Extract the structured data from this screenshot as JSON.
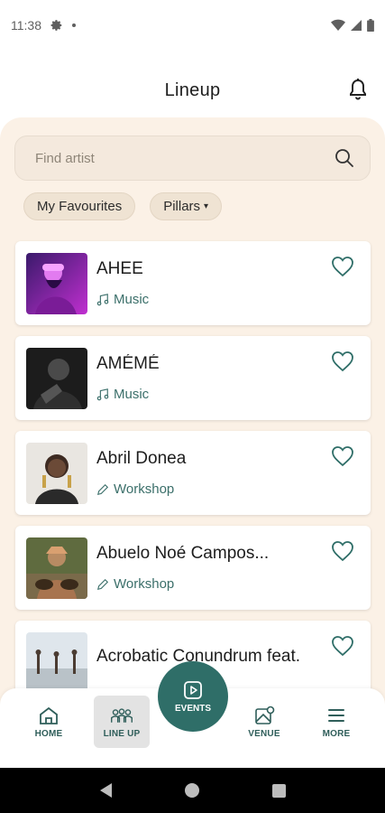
{
  "status_bar": {
    "time": "11:38"
  },
  "header": {
    "title": "Lineup"
  },
  "search": {
    "placeholder": "Find artist"
  },
  "filters": [
    {
      "label": "My Favourites"
    },
    {
      "label": "Pillars",
      "caret": "▾"
    }
  ],
  "artists": [
    {
      "name": "AHEE",
      "pillar": "Music",
      "pillar_icon": "music-note-icon",
      "favourite": false
    },
    {
      "name": "AMÉMÉ",
      "pillar": "Music",
      "pillar_icon": "music-note-icon",
      "favourite": false
    },
    {
      "name": "Abril Donea",
      "pillar": "Workshop",
      "pillar_icon": "pencil-icon",
      "favourite": false
    },
    {
      "name": "Abuelo Noé Campos...",
      "pillar": "Workshop",
      "pillar_icon": "pencil-icon",
      "favourite": false
    },
    {
      "name": "Acrobatic Conundrum feat.",
      "pillar": "",
      "pillar_icon": "",
      "favourite": false
    }
  ],
  "nav": {
    "home": "HOME",
    "lineup": "LINE UP",
    "events": "EVENTS",
    "venue": "VENUE",
    "more": "MORE",
    "active": "lineup"
  },
  "colors": {
    "accent": "#2f6e68",
    "teal_text": "#3b6f6a",
    "panel_bg": "#fbf1e6",
    "search_bg": "#f4e9dd",
    "chip_bg": "#efe3d3"
  }
}
